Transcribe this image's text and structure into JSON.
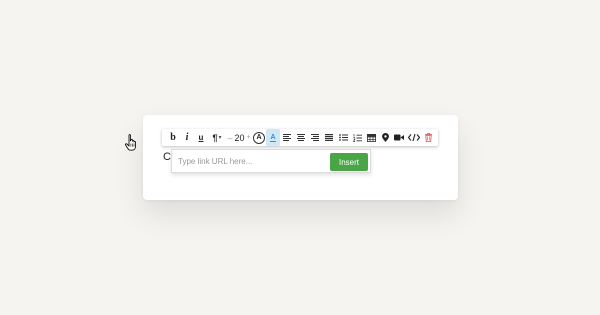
{
  "toolbar": {
    "bold": "b",
    "italic": "i",
    "underline": "u",
    "paragraph": "¶",
    "paragraph_caret": "▾",
    "font_size_minus": "–",
    "font_size": "20",
    "font_size_plus": "+",
    "text_color": "A",
    "link_label": "A",
    "icons": [
      "bold-icon",
      "italic-icon",
      "underline-icon",
      "paragraph-icon",
      "font-size-stepper",
      "text-color-icon",
      "link-icon",
      "align-left-icon",
      "align-center-icon",
      "align-right-icon",
      "align-justify-icon",
      "bullet-list-icon",
      "numbered-list-icon",
      "table-icon",
      "map-pin-icon",
      "video-icon",
      "code-icon",
      "trash-icon"
    ],
    "active_color": "#cfe8f5",
    "trash_color": "#d9534f"
  },
  "link_popup": {
    "placeholder": "Type link URL here...",
    "insert_label": "Insert",
    "insert_color": "#4aa546"
  },
  "editor": {
    "text": "C"
  }
}
